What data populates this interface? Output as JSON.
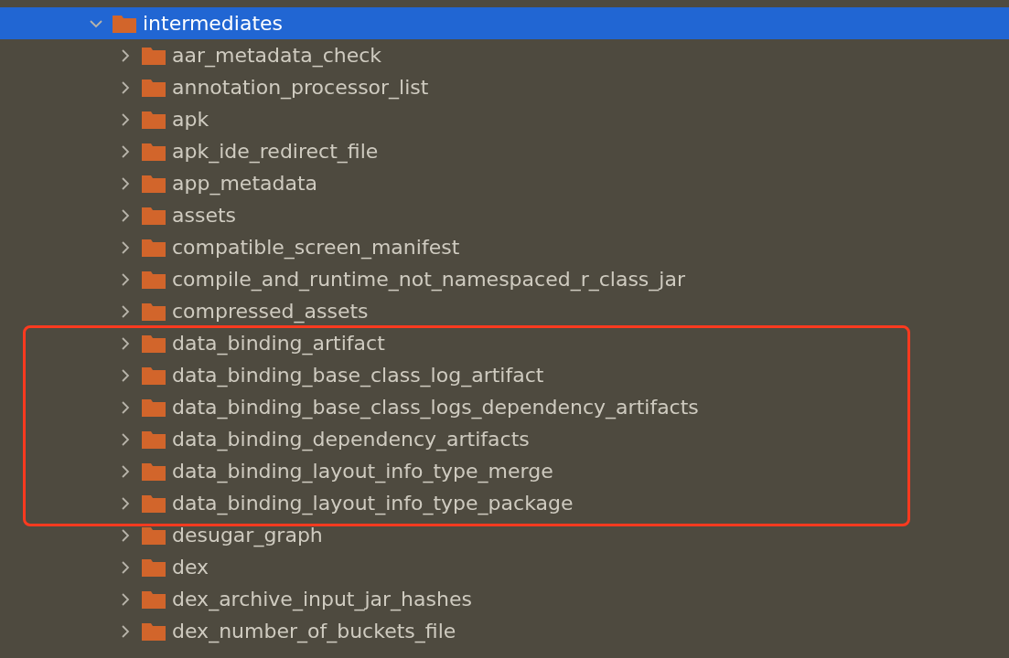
{
  "tree": [
    {
      "label": "intermediates",
      "expanded": true,
      "selected": true,
      "children": [
        {
          "kind": "folder",
          "label": "aar_metadata_check",
          "expanded": false,
          "selected": false
        },
        {
          "kind": "folder",
          "label": "annotation_processor_list",
          "expanded": false,
          "selected": false
        },
        {
          "kind": "folder",
          "label": "apk",
          "expanded": false,
          "selected": false
        },
        {
          "kind": "folder",
          "label": "apk_ide_redirect_file",
          "expanded": false,
          "selected": false
        },
        {
          "kind": "folder",
          "label": "app_metadata",
          "expanded": false,
          "selected": false
        },
        {
          "kind": "folder",
          "label": "assets",
          "expanded": false,
          "selected": false
        },
        {
          "kind": "folder",
          "label": "compatible_screen_manifest",
          "expanded": false,
          "selected": false
        },
        {
          "kind": "folder",
          "label": "compile_and_runtime_not_namespaced_r_class_jar",
          "expanded": false,
          "selected": false
        },
        {
          "kind": "folder",
          "label": "compressed_assets",
          "expanded": false,
          "selected": false
        },
        {
          "kind": "highlight",
          "items": [
            {
              "label": "data_binding_artifact",
              "expanded": false,
              "selected": false
            },
            {
              "label": "data_binding_base_class_log_artifact",
              "expanded": false,
              "selected": false
            },
            {
              "label": "data_binding_base_class_logs_dependency_artifacts",
              "expanded": false,
              "selected": false
            },
            {
              "label": "data_binding_dependency_artifacts",
              "expanded": false,
              "selected": false
            },
            {
              "label": "data_binding_layout_info_type_merge",
              "expanded": false,
              "selected": false
            },
            {
              "label": "data_binding_layout_info_type_package",
              "expanded": false,
              "selected": false
            }
          ]
        },
        {
          "kind": "folder",
          "label": "desugar_graph",
          "expanded": false,
          "selected": false
        },
        {
          "kind": "folder",
          "label": "dex",
          "expanded": false,
          "selected": false
        },
        {
          "kind": "folder",
          "label": "dex_archive_input_jar_hashes",
          "expanded": false,
          "selected": false
        },
        {
          "kind": "folder",
          "label": "dex_number_of_buckets_file",
          "expanded": false,
          "selected": false
        }
      ]
    }
  ]
}
